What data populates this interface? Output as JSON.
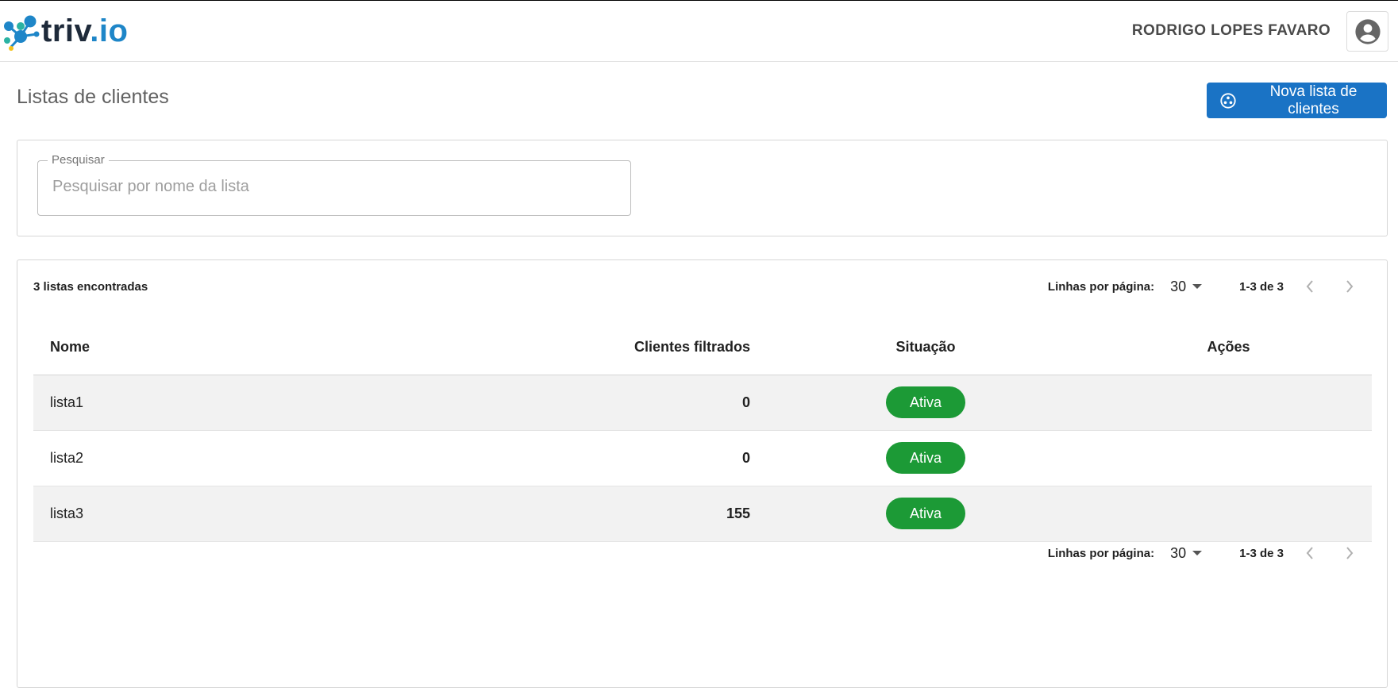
{
  "brand": {
    "logo_part1": "triv",
    "logo_part2": ".io"
  },
  "header": {
    "user_name": "RODRIGO LOPES FAVARO"
  },
  "page": {
    "title": "Listas de clientes",
    "new_button_label": "Nova lista de clientes"
  },
  "search": {
    "label": "Pesquisar",
    "placeholder": "Pesquisar por nome da lista",
    "value": ""
  },
  "results": {
    "count_label": "3 listas encontradas"
  },
  "pagination": {
    "rows_per_page_label": "Linhas por página:",
    "rows_per_page_value": "30",
    "range_label": "1-3 de 3"
  },
  "table": {
    "headers": {
      "name": "Nome",
      "filtered_clients": "Clientes filtrados",
      "status": "Situação",
      "actions": "Ações"
    },
    "rows": [
      {
        "name": "lista1",
        "filtered_clients": "0",
        "status": "Ativa"
      },
      {
        "name": "lista2",
        "filtered_clients": "0",
        "status": "Ativa"
      },
      {
        "name": "lista3",
        "filtered_clients": "155",
        "status": "Ativa"
      }
    ]
  },
  "colors": {
    "primary": "#1a73c5",
    "status_active": "#1c9a36",
    "row_stripe": "#f2f2f2"
  },
  "icons": {
    "logo": "molecule-logo-icon",
    "avatar": "account-circle-icon",
    "new_button": "list-add-icon",
    "dropdown": "caret-down-icon",
    "prev": "chevron-left-icon",
    "next": "chevron-right-icon"
  }
}
